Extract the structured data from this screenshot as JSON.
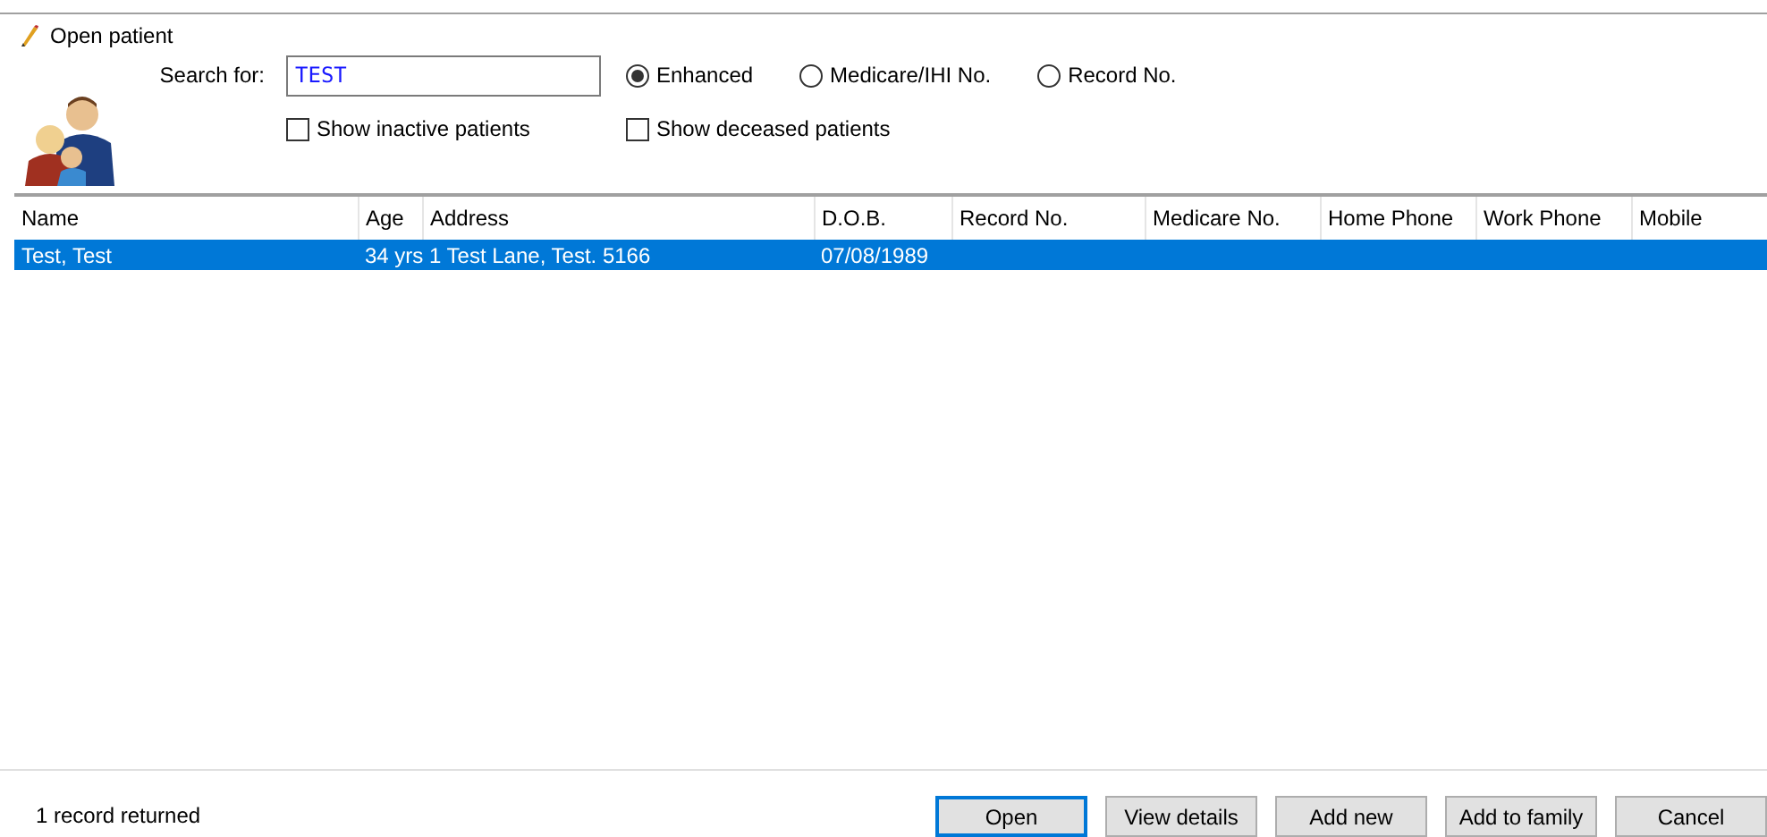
{
  "window": {
    "title": "Open patient"
  },
  "search": {
    "label": "Search for:",
    "value": "TEST"
  },
  "search_modes": [
    {
      "label": "Enhanced",
      "selected": true
    },
    {
      "label": "Medicare/IHI No.",
      "selected": false
    },
    {
      "label": "Record No.",
      "selected": false
    }
  ],
  "filters": [
    {
      "label": "Show inactive patients",
      "checked": false
    },
    {
      "label": "Show deceased patients",
      "checked": false
    }
  ],
  "table": {
    "columns": [
      "Name",
      "Age",
      "Address",
      "D.O.B.",
      "Record No.",
      "Medicare No.",
      "Home Phone",
      "Work Phone",
      "Mobile"
    ],
    "rows": [
      {
        "selected": true,
        "cells": [
          "Test, Test",
          "34 yrs",
          "1 Test Lane, Test. 5166",
          "07/08/1989",
          "",
          "",
          "",
          "",
          ""
        ]
      }
    ]
  },
  "status_bar": {
    "text": "1 record returned"
  },
  "buttons": [
    {
      "label": "Open",
      "default": true
    },
    {
      "label": "View details",
      "default": false
    },
    {
      "label": "Add new",
      "default": false
    },
    {
      "label": "Add to family",
      "default": false
    },
    {
      "label": "Cancel",
      "default": false
    }
  ]
}
